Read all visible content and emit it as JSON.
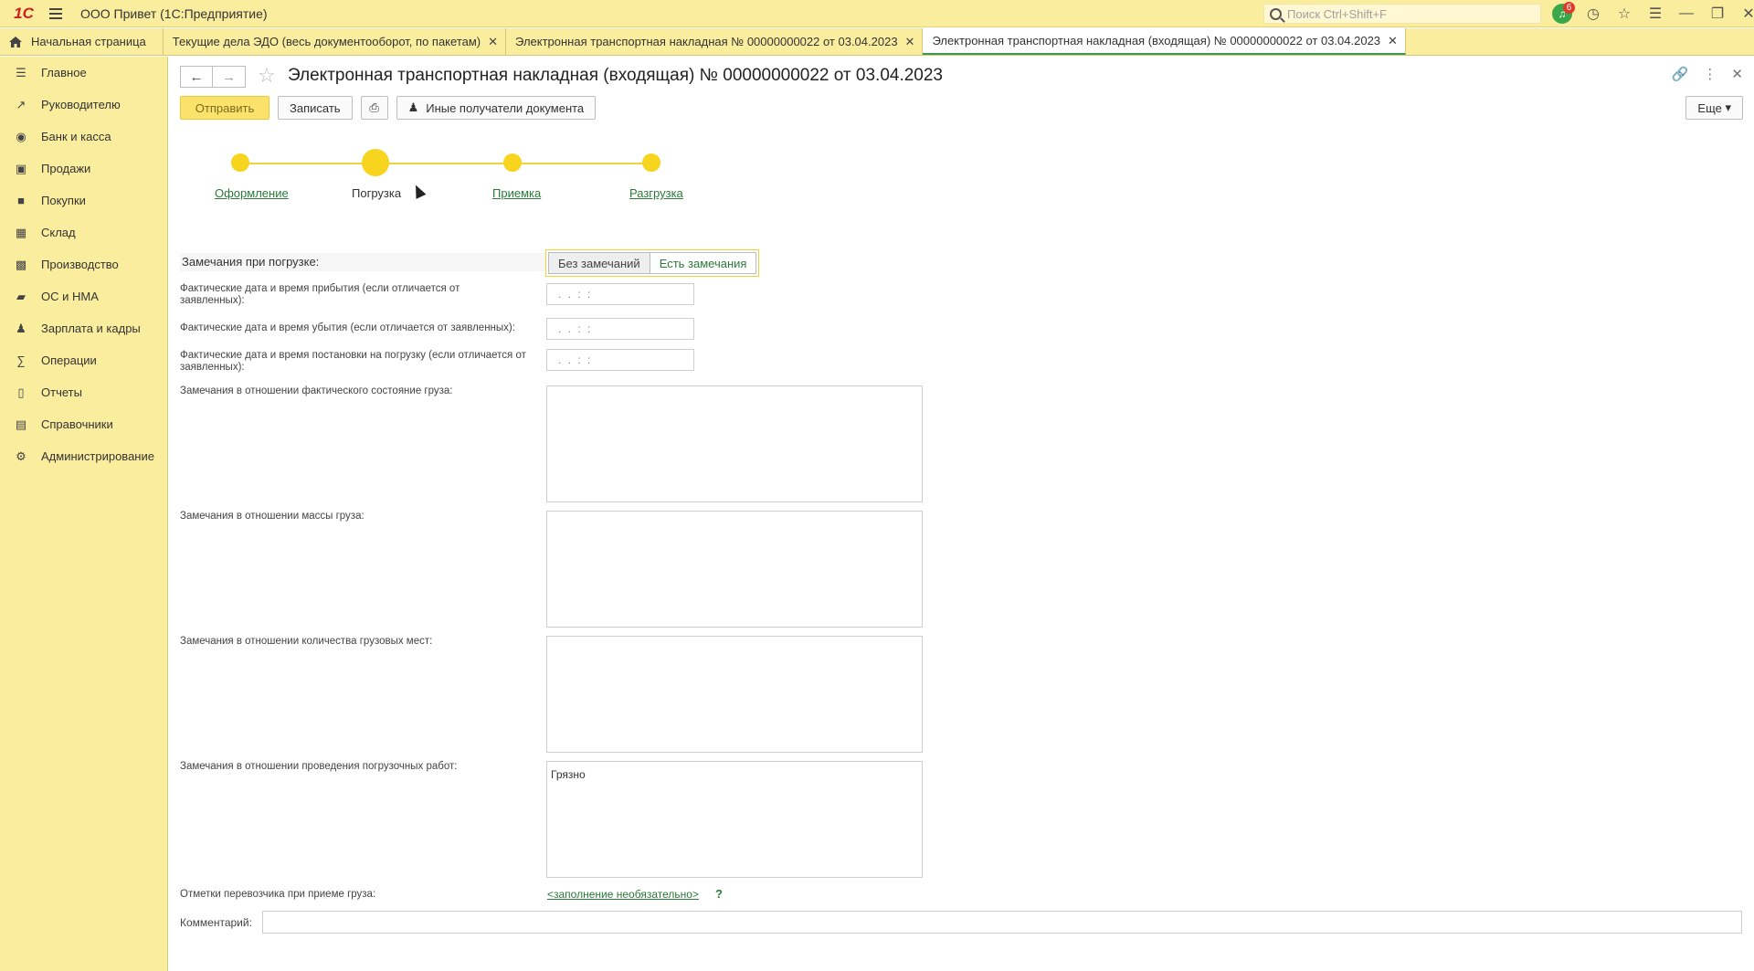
{
  "titlebar": {
    "logo": "1С",
    "app_title": "ООО Привет  (1С:Предприятие)",
    "search_placeholder": "Поиск Ctrl+Shift+F",
    "notifications_count": "6"
  },
  "tabs": [
    {
      "label": "Начальная страница"
    },
    {
      "label": "Текущие дела ЭДО (весь документооборот, по пакетам)"
    },
    {
      "label": "Электронная транспортная накладная № 00000000022 от 03.04.2023"
    },
    {
      "label": "Электронная транспортная накладная (входящая) № 00000000022 от 03.04.2023"
    }
  ],
  "sidebar": {
    "items": [
      {
        "label": "Главное",
        "icon": "menu-lines-icon"
      },
      {
        "label": "Руководителю",
        "icon": "trend-icon"
      },
      {
        "label": "Банк и касса",
        "icon": "coin-icon"
      },
      {
        "label": "Продажи",
        "icon": "bag-icon"
      },
      {
        "label": "Покупки",
        "icon": "cart-icon"
      },
      {
        "label": "Склад",
        "icon": "grid-icon"
      },
      {
        "label": "Производство",
        "icon": "factory-icon"
      },
      {
        "label": "ОС и НМА",
        "icon": "truck-icon"
      },
      {
        "label": "Зарплата и кадры",
        "icon": "person-icon"
      },
      {
        "label": "Операции",
        "icon": "operations-icon"
      },
      {
        "label": "Отчеты",
        "icon": "bar-chart-icon"
      },
      {
        "label": "Справочники",
        "icon": "books-icon"
      },
      {
        "label": "Администрирование",
        "icon": "gear-icon"
      }
    ]
  },
  "document": {
    "title": "Электронная транспортная накладная (входящая) № 00000000022 от 03.04.2023"
  },
  "toolbar": {
    "send_label": "Отправить",
    "save_label": "Записать",
    "other_recipients_label": "Иные получатели документа",
    "more_label": "Еще"
  },
  "stepper": {
    "steps": [
      {
        "label": "Оформление"
      },
      {
        "label": "Погрузка"
      },
      {
        "label": "Приемка"
      },
      {
        "label": "Разгрузка"
      }
    ],
    "current_index": 1
  },
  "form": {
    "remarks_label": "Замечания при погрузке:",
    "radio_no_remarks": "Без замечаний",
    "radio_has_remarks": "Есть замечания",
    "arrival_label": "Фактические дата и время прибытия (если отличается от заявленных):",
    "departure_label": "Фактические дата и время убытия (если отличается от заявленных):",
    "loading_label": "Фактические дата и время постановки на погрузку (если отличается от заявленных):",
    "date_mask": ".  .      :  :",
    "condition_label": "Замечания в отношении фактического состояние груза:",
    "mass_label": "Замечания в отношении массы груза:",
    "places_label": "Замечания в отношении количества грузовых мест:",
    "works_label": "Замечания в отношении проведения погрузочных работ:",
    "works_value": "Грязно",
    "carrier_marks_label": "Отметки перевозчика при приеме груза:",
    "carrier_marks_link": "<заполнение необязательно>",
    "help_mark": "?",
    "comment_label": "Комментарий:"
  }
}
